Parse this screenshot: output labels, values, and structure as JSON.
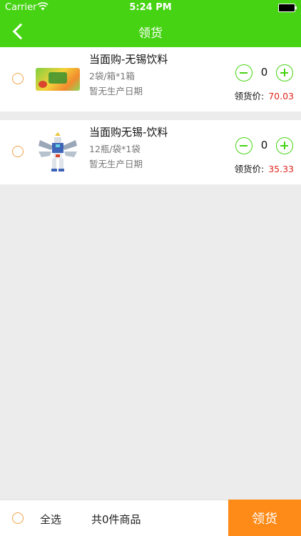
{
  "status_bar": {
    "carrier": "Carrier",
    "time": "5:24 PM",
    "wifi_icon": "wifi-icon",
    "battery_icon": "battery-icon"
  },
  "nav": {
    "title": "领货",
    "back_icon": "chevron-left-icon",
    "color": "#46d313"
  },
  "items": [
    {
      "name": "当面购-无锡饮料",
      "spec": "2袋/箱*1箱",
      "date": "暂无生产日期",
      "quantity": "0",
      "price_label": "领货价:",
      "price": "70.03",
      "thumb_icon": "drink-banner-image"
    },
    {
      "name": "当面购无锡-饮料",
      "spec": "12瓶/袋*1袋",
      "date": "暂无生产日期",
      "quantity": "0",
      "price_label": "领货价:",
      "price": "35.33",
      "thumb_icon": "robot-figure-image"
    }
  ],
  "footer": {
    "select_all": "全选",
    "total": "共0件商品",
    "submit": "领货",
    "submit_color": "#fe8a17"
  },
  "colors": {
    "accent": "#46d313",
    "price": "#e0261c",
    "radio": "#f2a24a"
  }
}
